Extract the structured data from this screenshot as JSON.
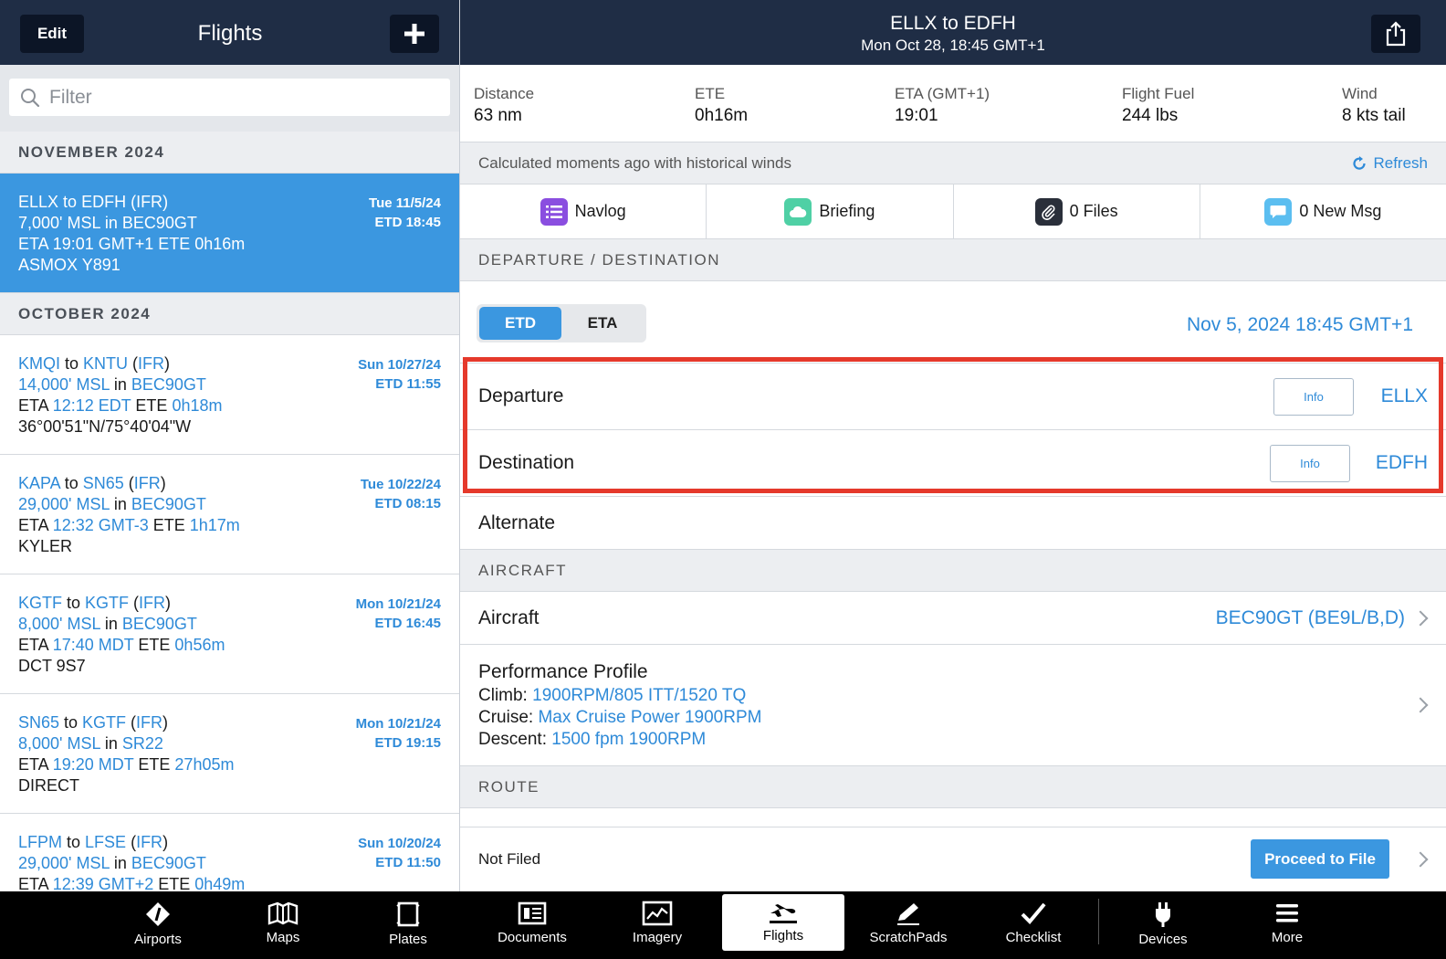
{
  "left": {
    "edit_label": "Edit",
    "title": "Flights",
    "filter_placeholder": "Filter",
    "groups": [
      {
        "month": "NOVEMBER 2024",
        "flights": [
          {
            "from": "ELLX",
            "to": "EDFH",
            "rule": "IFR",
            "alt": "7,000' MSL",
            "aircraft": "BEC90GT",
            "eta": "19:01 GMT+1",
            "ete": "0h16m",
            "route": "ASMOX Y891",
            "date": "Tue 11/5/24",
            "etd": "ETD 18:45"
          }
        ]
      },
      {
        "month": "OCTOBER 2024",
        "flights": [
          {
            "from": "KMQI",
            "to": "KNTU",
            "rule": "IFR",
            "alt": "14,000' MSL",
            "aircraft": "BEC90GT",
            "eta": "12:12 EDT",
            "ete": "0h18m",
            "route": "36°00'51\"N/75°40'04\"W",
            "date": "Sun 10/27/24",
            "etd": "ETD 11:55"
          },
          {
            "from": "KAPA",
            "to": "SN65",
            "rule": "IFR",
            "alt": "29,000' MSL",
            "aircraft": "BEC90GT",
            "eta": "12:32 GMT-3",
            "ete": "1h17m",
            "route": "KYLER",
            "date": "Tue 10/22/24",
            "etd": "ETD 08:15"
          },
          {
            "from": "KGTF",
            "to": "KGTF",
            "rule": "IFR",
            "alt": "8,000' MSL",
            "aircraft": "BEC90GT",
            "eta": "17:40 MDT",
            "ete": "0h56m",
            "route": "DCT 9S7",
            "date": "Mon 10/21/24",
            "etd": "ETD 16:45"
          },
          {
            "from": "SN65",
            "to": "KGTF",
            "rule": "IFR",
            "alt": "8,000' MSL",
            "aircraft": "SR22",
            "eta": "19:20 MDT",
            "ete": "27h05m",
            "route": "DIRECT",
            "date": "Mon 10/21/24",
            "etd": "ETD 19:15"
          },
          {
            "from": "LFPM",
            "to": "LFSE",
            "rule": "IFR",
            "alt": "29,000' MSL",
            "aircraft": "BEC90GT",
            "eta": "12:39 GMT+2",
            "ete": "0h49m",
            "route": "",
            "date": "Sun 10/20/24",
            "etd": "ETD 11:50"
          }
        ]
      }
    ],
    "words": {
      "to": "to",
      "in": "in",
      "eta": "ETA",
      "ete": "ETE"
    }
  },
  "header": {
    "title": "ELLX to EDFH",
    "subtitle": "Mon Oct 28, 18:45 GMT+1"
  },
  "stats": [
    {
      "label": "Distance",
      "value": "63 nm"
    },
    {
      "label": "ETE",
      "value": "0h16m"
    },
    {
      "label": "ETA (GMT+1)",
      "value": "19:01"
    },
    {
      "label": "Flight Fuel",
      "value": "244 lbs"
    },
    {
      "label": "Wind",
      "value": "8 kts tail"
    }
  ],
  "calc_note": "Calculated moments ago with historical winds",
  "refresh_label": "Refresh",
  "tools": [
    {
      "label": "Navlog",
      "icon": "list-icon",
      "color": "#8a4ee0"
    },
    {
      "label": "Briefing",
      "icon": "cloud-icon",
      "color": "#4fd0a5"
    },
    {
      "label": "0 Files",
      "icon": "paperclip-icon",
      "color": "#2a2f3a"
    },
    {
      "label": "0 New Msg",
      "icon": "message-icon",
      "color": "#5bbef0"
    }
  ],
  "sections": {
    "dep_dest": "DEPARTURE / DESTINATION",
    "aircraft": "AIRCRAFT",
    "route": "ROUTE"
  },
  "time_toggle": {
    "etd": "ETD",
    "eta": "ETA",
    "value": "Nov 5, 2024 18:45 GMT+1"
  },
  "departure": {
    "label": "Departure",
    "info": "Info",
    "code": "ELLX"
  },
  "destination": {
    "label": "Destination",
    "info": "Info",
    "code": "EDFH"
  },
  "alternate": {
    "label": "Alternate"
  },
  "aircraft_row": {
    "label": "Aircraft",
    "value": "BEC90GT (BE9L/B,D)"
  },
  "performance": {
    "title": "Performance Profile",
    "climb_label": "Climb:",
    "climb": "1900RPM/805 ITT/1520 TQ",
    "cruise_label": "Cruise:",
    "cruise": "Max Cruise Power 1900RPM",
    "descent_label": "Descent:",
    "descent": "1500 fpm 1900RPM"
  },
  "filing": {
    "status": "Not Filed",
    "button": "Proceed to File"
  },
  "tabbar": [
    {
      "label": "Airports",
      "icon": "airport-icon"
    },
    {
      "label": "Maps",
      "icon": "map-icon"
    },
    {
      "label": "Plates",
      "icon": "plates-icon"
    },
    {
      "label": "Documents",
      "icon": "documents-icon"
    },
    {
      "label": "Imagery",
      "icon": "imagery-icon"
    },
    {
      "label": "Flights",
      "icon": "plane-icon"
    },
    {
      "label": "ScratchPads",
      "icon": "pencil-icon"
    },
    {
      "label": "Checklist",
      "icon": "checkmark-icon"
    },
    {
      "label": "Devices",
      "icon": "plug-icon"
    },
    {
      "label": "More",
      "icon": "menu-icon"
    }
  ]
}
